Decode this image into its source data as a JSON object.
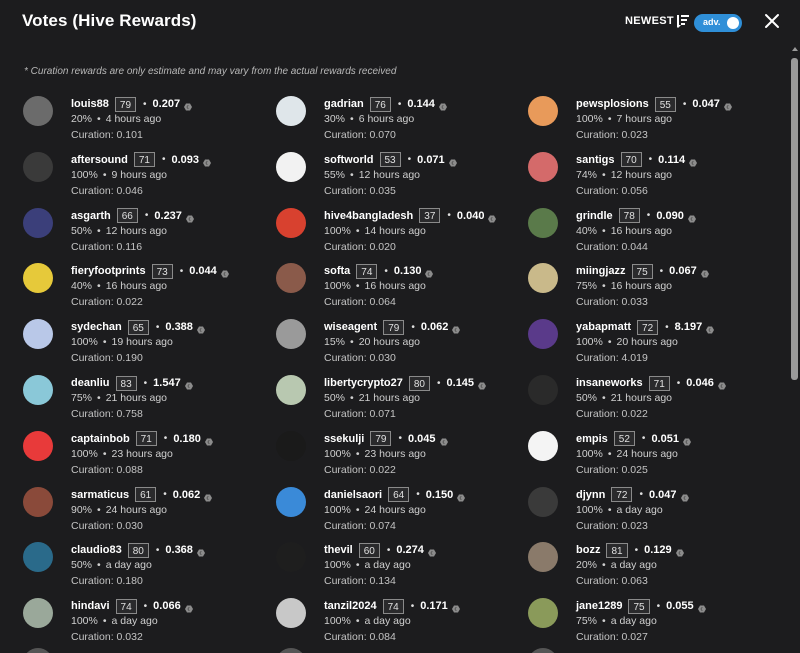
{
  "header": {
    "title": "Votes (Hive Rewards)",
    "sort_label": "NEWEST",
    "toggle_label": "adv.",
    "accent_color": "#2f8fd8"
  },
  "note": "* Curation rewards are only estimate and may vary from the actual rewards received",
  "labels": {
    "curation_prefix": "Curation: ",
    "separator": "•"
  },
  "votes": [
    {
      "voter": "louis88",
      "rep": "79",
      "amount": "0.207",
      "percent": "20%",
      "time": "4 hours ago",
      "curation": "0.101",
      "avatar_color": "#6b6b6b"
    },
    {
      "voter": "gadrian",
      "rep": "76",
      "amount": "0.144",
      "percent": "30%",
      "time": "6 hours ago",
      "curation": "0.070",
      "avatar_color": "#dfe6ea"
    },
    {
      "voter": "pewsplosions",
      "rep": "55",
      "amount": "0.047",
      "percent": "100%",
      "time": "7 hours ago",
      "curation": "0.023",
      "avatar_color": "#e89a5a"
    },
    {
      "voter": "aftersound",
      "rep": "71",
      "amount": "0.093",
      "percent": "100%",
      "time": "9 hours ago",
      "curation": "0.046",
      "avatar_color": "#3a3a3a"
    },
    {
      "voter": "softworld",
      "rep": "53",
      "amount": "0.071",
      "percent": "55%",
      "time": "12 hours ago",
      "curation": "0.035",
      "avatar_color": "#f2f2f2"
    },
    {
      "voter": "santigs",
      "rep": "70",
      "amount": "0.114",
      "percent": "74%",
      "time": "12 hours ago",
      "curation": "0.056",
      "avatar_color": "#d46a6a"
    },
    {
      "voter": "asgarth",
      "rep": "66",
      "amount": "0.237",
      "percent": "50%",
      "time": "12 hours ago",
      "curation": "0.116",
      "avatar_color": "#3b3f7a"
    },
    {
      "voter": "hive4bangladesh",
      "rep": "37",
      "amount": "0.040",
      "percent": "100%",
      "time": "14 hours ago",
      "curation": "0.020",
      "avatar_color": "#d8412f"
    },
    {
      "voter": "grindle",
      "rep": "78",
      "amount": "0.090",
      "percent": "40%",
      "time": "16 hours ago",
      "curation": "0.044",
      "avatar_color": "#5a7a4a"
    },
    {
      "voter": "fieryfootprints",
      "rep": "73",
      "amount": "0.044",
      "percent": "40%",
      "time": "16 hours ago",
      "curation": "0.022",
      "avatar_color": "#e6c93a"
    },
    {
      "voter": "softa",
      "rep": "74",
      "amount": "0.130",
      "percent": "100%",
      "time": "16 hours ago",
      "curation": "0.064",
      "avatar_color": "#8a5a4a"
    },
    {
      "voter": "miingjazz",
      "rep": "75",
      "amount": "0.067",
      "percent": "75%",
      "time": "16 hours ago",
      "curation": "0.033",
      "avatar_color": "#c9b98a"
    },
    {
      "voter": "sydechan",
      "rep": "65",
      "amount": "0.388",
      "percent": "100%",
      "time": "19 hours ago",
      "curation": "0.190",
      "avatar_color": "#b9c8e8"
    },
    {
      "voter": "wiseagent",
      "rep": "79",
      "amount": "0.062",
      "percent": "15%",
      "time": "20 hours ago",
      "curation": "0.030",
      "avatar_color": "#9a9a9a"
    },
    {
      "voter": "yabapmatt",
      "rep": "72",
      "amount": "8.197",
      "percent": "100%",
      "time": "20 hours ago",
      "curation": "4.019",
      "avatar_color": "#5a3a8a"
    },
    {
      "voter": "deanliu",
      "rep": "83",
      "amount": "1.547",
      "percent": "75%",
      "time": "21 hours ago",
      "curation": "0.758",
      "avatar_color": "#8ac8d8"
    },
    {
      "voter": "libertycrypto27",
      "rep": "80",
      "amount": "0.145",
      "percent": "50%",
      "time": "21 hours ago",
      "curation": "0.071",
      "avatar_color": "#b8c8b0"
    },
    {
      "voter": "insaneworks",
      "rep": "71",
      "amount": "0.046",
      "percent": "50%",
      "time": "21 hours ago",
      "curation": "0.022",
      "avatar_color": "#2a2a2a"
    },
    {
      "voter": "captainbob",
      "rep": "71",
      "amount": "0.180",
      "percent": "100%",
      "time": "23 hours ago",
      "curation": "0.088",
      "avatar_color": "#e83a3a"
    },
    {
      "voter": "ssekulji",
      "rep": "79",
      "amount": "0.045",
      "percent": "100%",
      "time": "23 hours ago",
      "curation": "0.022",
      "avatar_color": "#1a1a1a"
    },
    {
      "voter": "empis",
      "rep": "52",
      "amount": "0.051",
      "percent": "100%",
      "time": "24 hours ago",
      "curation": "0.025",
      "avatar_color": "#f4f4f4"
    },
    {
      "voter": "sarmaticus",
      "rep": "61",
      "amount": "0.062",
      "percent": "90%",
      "time": "24 hours ago",
      "curation": "0.030",
      "avatar_color": "#8a4a3a"
    },
    {
      "voter": "danielsaori",
      "rep": "64",
      "amount": "0.150",
      "percent": "100%",
      "time": "24 hours ago",
      "curation": "0.074",
      "avatar_color": "#3a8ad8"
    },
    {
      "voter": "djynn",
      "rep": "72",
      "amount": "0.047",
      "percent": "100%",
      "time": "a day ago",
      "curation": "0.023",
      "avatar_color": "#3a3a3a"
    },
    {
      "voter": "claudio83",
      "rep": "80",
      "amount": "0.368",
      "percent": "50%",
      "time": "a day ago",
      "curation": "0.180",
      "avatar_color": "#2a6a8a"
    },
    {
      "voter": "thevil",
      "rep": "60",
      "amount": "0.274",
      "percent": "100%",
      "time": "a day ago",
      "curation": "0.134",
      "avatar_color": "#1e1e1e"
    },
    {
      "voter": "bozz",
      "rep": "81",
      "amount": "0.129",
      "percent": "20%",
      "time": "a day ago",
      "curation": "0.063",
      "avatar_color": "#8a7a6a"
    },
    {
      "voter": "hindavi",
      "rep": "74",
      "amount": "0.066",
      "percent": "100%",
      "time": "a day ago",
      "curation": "0.032",
      "avatar_color": "#9aa89a"
    },
    {
      "voter": "tanzil2024",
      "rep": "74",
      "amount": "0.171",
      "percent": "100%",
      "time": "a day ago",
      "curation": "0.084",
      "avatar_color": "#c8c8c8"
    },
    {
      "voter": "jane1289",
      "rep": "75",
      "amount": "0.055",
      "percent": "75%",
      "time": "a day ago",
      "curation": "0.027",
      "avatar_color": "#8a9a5a"
    }
  ]
}
